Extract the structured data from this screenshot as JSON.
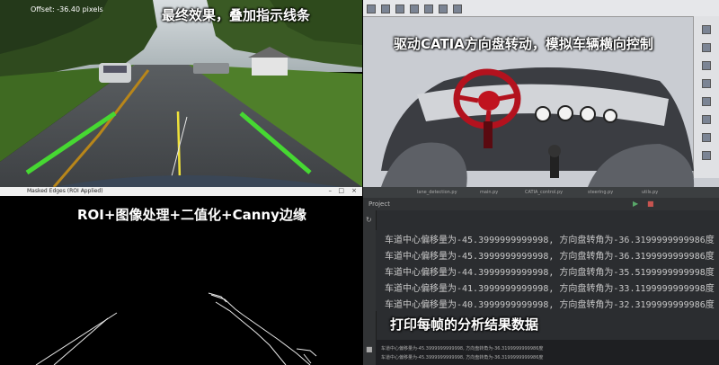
{
  "road_view": {
    "offset_label": "Offset: -36.40 pixels",
    "caption": "最终效果，叠加指示线条"
  },
  "catia_view": {
    "caption": "驱动CATIA方向盘转动，模拟车辆横向控制"
  },
  "edges_view": {
    "window_title": "Masked Edges (ROI Applied)",
    "caption": "ROI+图像处理+二值化+Canny边缘"
  },
  "ide_view": {
    "project_label": "Project",
    "tabs": [
      "lane_detection.py",
      "main.py",
      "CATIA_control.py",
      "steering.py",
      "utils.py"
    ],
    "console_lines": [
      "车道中心偏移量为-45.3999999999998, 方向盘转角为-36.3199999999986度",
      "车道中心偏移量为-45.3999999999998, 方向盘转角为-36.3199999999986度",
      "车道中心偏移量为-44.3999999999998, 方向盘转角为-35.5199999999998度",
      "车道中心偏移量为-41.3999999999998, 方向盘转角为-33.1199999999998度",
      "车道中心偏移量为-40.3999999999998, 方向盘转角为-32.3199999999986度"
    ],
    "bottom_lines": [
      "车道中心偏移量为-45.3999999999998, 方向盘转角为-36.3199999999986度",
      "车道中心偏移量为-45.3999999999998, 方向盘转角为-36.3199999999986度"
    ],
    "caption": "打印每帧的分析结果数据"
  }
}
